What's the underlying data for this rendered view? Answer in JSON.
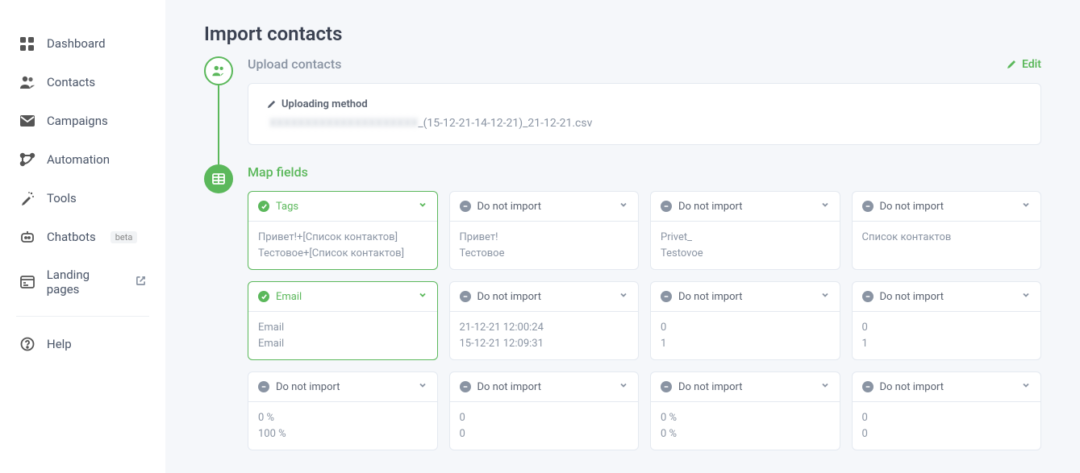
{
  "sidebar": {
    "items": [
      {
        "label": "Dashboard"
      },
      {
        "label": "Contacts"
      },
      {
        "label": "Campaigns"
      },
      {
        "label": "Automation"
      },
      {
        "label": "Tools"
      },
      {
        "label": "Chatbots",
        "badge": "beta"
      },
      {
        "label": "Landing pages",
        "external": true
      }
    ],
    "help": {
      "label": "Help"
    }
  },
  "page": {
    "title": "Import contacts",
    "steps": {
      "upload": {
        "title": "Upload contacts",
        "edit_label": "Edit",
        "method_label": "Uploading method",
        "file_prefix_blurred": "XXXXXXXXXXXXXXXXXXXXX",
        "file_suffix": "_(15-12-21-14-12-21)_21-12-21.csv"
      },
      "map": {
        "title": "Map fields",
        "do_not_import": "Do not import",
        "rows": [
          [
            {
              "mapped": true,
              "label": "Tags",
              "preview": [
                "Привет!+[Список контактов]",
                "Тестовое+[Список контактов]"
              ]
            },
            {
              "mapped": false,
              "label": "Do not import",
              "preview": [
                "Привет!",
                "Тестовое"
              ]
            },
            {
              "mapped": false,
              "label": "Do not import",
              "preview": [
                "Privet_",
                "Testovoe"
              ]
            },
            {
              "mapped": false,
              "label": "Do not import",
              "preview": [
                "Список контактов"
              ]
            }
          ],
          [
            {
              "mapped": true,
              "label": "Email",
              "preview": [
                "Email",
                "Email"
              ]
            },
            {
              "mapped": false,
              "label": "Do not import",
              "preview": [
                "21-12-21 12:00:24",
                "15-12-21 12:09:31"
              ]
            },
            {
              "mapped": false,
              "label": "Do not import",
              "preview": [
                "0",
                "1"
              ]
            },
            {
              "mapped": false,
              "label": "Do not import",
              "preview": [
                "0",
                "1"
              ]
            }
          ],
          [
            {
              "mapped": false,
              "label": "Do not import",
              "preview": [
                "0 %",
                "100 %"
              ]
            },
            {
              "mapped": false,
              "label": "Do not import",
              "preview": [
                "0",
                "0"
              ]
            },
            {
              "mapped": false,
              "label": "Do not import",
              "preview": [
                "0 %",
                "0 %"
              ]
            },
            {
              "mapped": false,
              "label": "Do not import",
              "preview": [
                "0",
                "0"
              ]
            }
          ]
        ]
      }
    }
  }
}
